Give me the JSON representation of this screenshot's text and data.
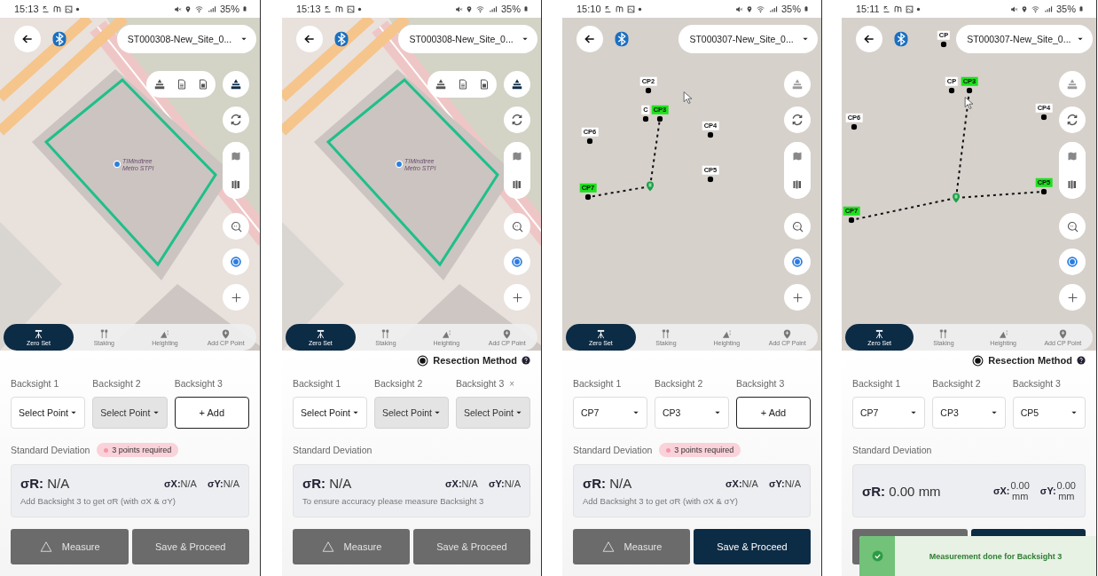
{
  "phones": [
    {
      "status_bar": {
        "time": "15:13",
        "battery": "35%"
      },
      "map": {
        "kind": "street",
        "place_label": [
          "TIMindtree",
          "Metro STPI"
        ],
        "tool_tray_expanded": true
      },
      "site_selector": {
        "value": "ST000308-New_Site_0..."
      },
      "tabs": [
        {
          "label": "Zero Set",
          "selected": true
        },
        {
          "label": "Staking",
          "selected": false
        },
        {
          "label": "Heighting",
          "selected": false
        },
        {
          "label": "Add CP Point",
          "selected": false
        }
      ],
      "backsights": [
        {
          "label": "Backsight 1",
          "kind": "select",
          "value": "Select Point",
          "disabled": false
        },
        {
          "label": "Backsight 2",
          "kind": "select",
          "value": "Select Point",
          "disabled": true
        },
        {
          "label": "Backsight 3",
          "kind": "add",
          "value": "+ Add"
        }
      ],
      "standard_deviation": {
        "label": "Standard Deviation",
        "badge": "3 points required"
      },
      "results": {
        "sigma_r": {
          "label": "σR:",
          "value": "N/A"
        },
        "sigma_x": {
          "label": "σX:",
          "value": "N/A"
        },
        "sigma_y": {
          "label": "σY:",
          "value": "N/A"
        },
        "note": "Add Backsight 3 to get σR (with σX & σY)"
      },
      "buttons": {
        "measure": {
          "label": "Measure",
          "disabled": true
        },
        "save": {
          "label": "Save & Proceed",
          "disabled": true
        }
      }
    },
    {
      "status_bar": {
        "time": "15:13",
        "battery": "35%"
      },
      "map": {
        "kind": "street",
        "place_label": [
          "TIMindtree",
          "Metro STPI"
        ],
        "tool_tray_expanded": true
      },
      "site_selector": {
        "value": "ST000308-New_Site_0..."
      },
      "tabs": [
        {
          "label": "Zero Set",
          "selected": true
        },
        {
          "label": "Staking",
          "selected": false
        },
        {
          "label": "Heighting",
          "selected": false
        },
        {
          "label": "Add CP Point",
          "selected": false
        }
      ],
      "resection": {
        "label": "Resection Method",
        "selected": true
      },
      "backsights": [
        {
          "label": "Backsight 1",
          "kind": "select",
          "value": "Select Point",
          "disabled": false
        },
        {
          "label": "Backsight 2",
          "kind": "select",
          "value": "Select Point",
          "disabled": true
        },
        {
          "label": "Backsight 3",
          "kind": "select",
          "value": "Select Point",
          "disabled": true,
          "remove": "×"
        }
      ],
      "standard_deviation": {
        "label": "Standard Deviation"
      },
      "results": {
        "sigma_r": {
          "label": "σR:",
          "value": "N/A"
        },
        "sigma_x": {
          "label": "σX:",
          "value": "N/A"
        },
        "sigma_y": {
          "label": "σY:",
          "value": "N/A"
        },
        "note": "To ensure accuracy please measure Backsight 3"
      },
      "buttons": {
        "measure": {
          "label": "Measure",
          "disabled": true
        },
        "save": {
          "label": "Save & Proceed",
          "disabled": true
        }
      }
    },
    {
      "status_bar": {
        "time": "15:10",
        "battery": "35%"
      },
      "map": {
        "kind": "points",
        "tool_tray_expanded": false,
        "points": [
          {
            "label": "CP2",
            "selected": false
          },
          {
            "label": "C",
            "selected": false
          },
          {
            "label": "CP3",
            "selected": true
          },
          {
            "label": "CP6",
            "selected": false
          },
          {
            "label": "CP4",
            "selected": false
          },
          {
            "label": "CP5",
            "selected": false
          },
          {
            "label": "CP7",
            "selected": true
          }
        ]
      },
      "site_selector": {
        "value": "ST000307-New_Site_0..."
      },
      "tabs": [
        {
          "label": "Zero Set",
          "selected": true
        },
        {
          "label": "Staking",
          "selected": false
        },
        {
          "label": "Heighting",
          "selected": false
        },
        {
          "label": "Add CP Point",
          "selected": false
        }
      ],
      "backsights": [
        {
          "label": "Backsight 1",
          "kind": "select",
          "value": "CP7",
          "disabled": false
        },
        {
          "label": "Backsight 2",
          "kind": "select",
          "value": "CP3",
          "disabled": false
        },
        {
          "label": "Backsight 3",
          "kind": "add",
          "value": "+ Add"
        }
      ],
      "standard_deviation": {
        "label": "Standard Deviation",
        "badge": "3 points required"
      },
      "results": {
        "sigma_r": {
          "label": "σR:",
          "value": "N/A"
        },
        "sigma_x": {
          "label": "σX:",
          "value": "N/A"
        },
        "sigma_y": {
          "label": "σY:",
          "value": "N/A"
        },
        "note": "Add Backsight 3 to get σR (with σX & σY)"
      },
      "buttons": {
        "measure": {
          "label": "Measure",
          "disabled": true
        },
        "save": {
          "label": "Save & Proceed",
          "disabled": false
        }
      }
    },
    {
      "status_bar": {
        "time": "15:11",
        "battery": "35%"
      },
      "map": {
        "kind": "points",
        "tool_tray_expanded": false,
        "points": [
          {
            "label": "CP",
            "selected": false
          },
          {
            "label": "CP",
            "selected": false
          },
          {
            "label": "CP3",
            "selected": true
          },
          {
            "label": "CP6",
            "selected": false
          },
          {
            "label": "CP4",
            "selected": false
          },
          {
            "label": "CP5",
            "selected": true
          },
          {
            "label": "CP7",
            "selected": true
          }
        ]
      },
      "site_selector": {
        "value": "ST000307-New_Site_0..."
      },
      "tabs": [
        {
          "label": "Zero Set",
          "selected": true
        },
        {
          "label": "Staking",
          "selected": false
        },
        {
          "label": "Heighting",
          "selected": false
        },
        {
          "label": "Add CP Point",
          "selected": false
        }
      ],
      "resection": {
        "label": "Resection Method",
        "selected": true
      },
      "backsights": [
        {
          "label": "Backsight 1",
          "kind": "select",
          "value": "CP7",
          "disabled": false
        },
        {
          "label": "Backsight 2",
          "kind": "select",
          "value": "CP3",
          "disabled": false
        },
        {
          "label": "Backsight 3",
          "kind": "select",
          "value": "CP5",
          "disabled": false
        }
      ],
      "standard_deviation": {
        "label": "Standard Deviation"
      },
      "results": {
        "sigma_r": {
          "label": "σR:",
          "value": "0.00 mm"
        },
        "sigma_x": {
          "label": "σX:",
          "value": "0.00",
          "unit": "mm"
        },
        "sigma_y": {
          "label": "σY:",
          "value": "0.00",
          "unit": "mm"
        }
      },
      "buttons": {
        "measure": {
          "disabled": true
        },
        "save": {
          "disabled": false
        }
      },
      "toast": {
        "text": "Measurement done for Backsight 3"
      }
    }
  ]
}
